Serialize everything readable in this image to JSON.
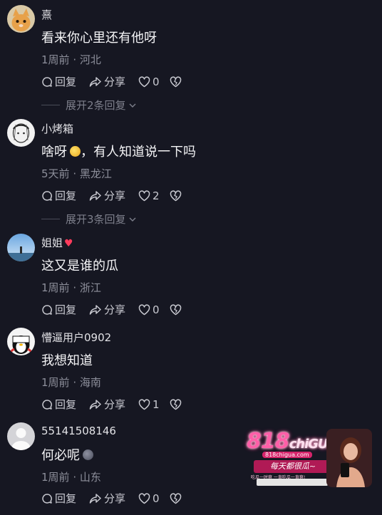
{
  "actions": {
    "reply": "回复",
    "share": "分享"
  },
  "comments": [
    {
      "username": "熹",
      "text": "看来你心里还有他呀",
      "time": "1周前",
      "location": "河北",
      "likes": "0",
      "expand": "展开2条回复",
      "heart": false
    },
    {
      "username": "小烤箱",
      "text": "啥呀",
      "text_after_emoji": "，有人知道说一下吗",
      "emoji": "smiling-face-emoji",
      "time": "5天前",
      "location": "黑龙江",
      "likes": "2",
      "expand": "展开3条回复",
      "heart": false
    },
    {
      "username": "姐姐",
      "text": "这又是谁的瓜",
      "time": "1周前",
      "location": "浙江",
      "likes": "0",
      "heart": true,
      "heart_glyph": "♥"
    },
    {
      "username": "懵逼用户0902",
      "text": "我想知道",
      "time": "1周前",
      "location": "海南",
      "likes": "1",
      "heart": false
    },
    {
      "username": "55141508146",
      "text": "何必呢",
      "emoji": "sweat-face-emoji",
      "time": "1周前",
      "location": "山东",
      "likes": "0",
      "heart": false
    }
  ],
  "meta_separator": "·",
  "ad": {
    "logo_number": "818",
    "logo_text": "chiGUA",
    "url": "818chigua.com",
    "slogan": "每天都很瓜~",
    "sub": "吃瓜一时爽 一直吃瓜一直爽!"
  },
  "colors": {
    "background": "#161722",
    "heart": "#ff3b5c",
    "ad_pink": "#ff5fa8"
  }
}
